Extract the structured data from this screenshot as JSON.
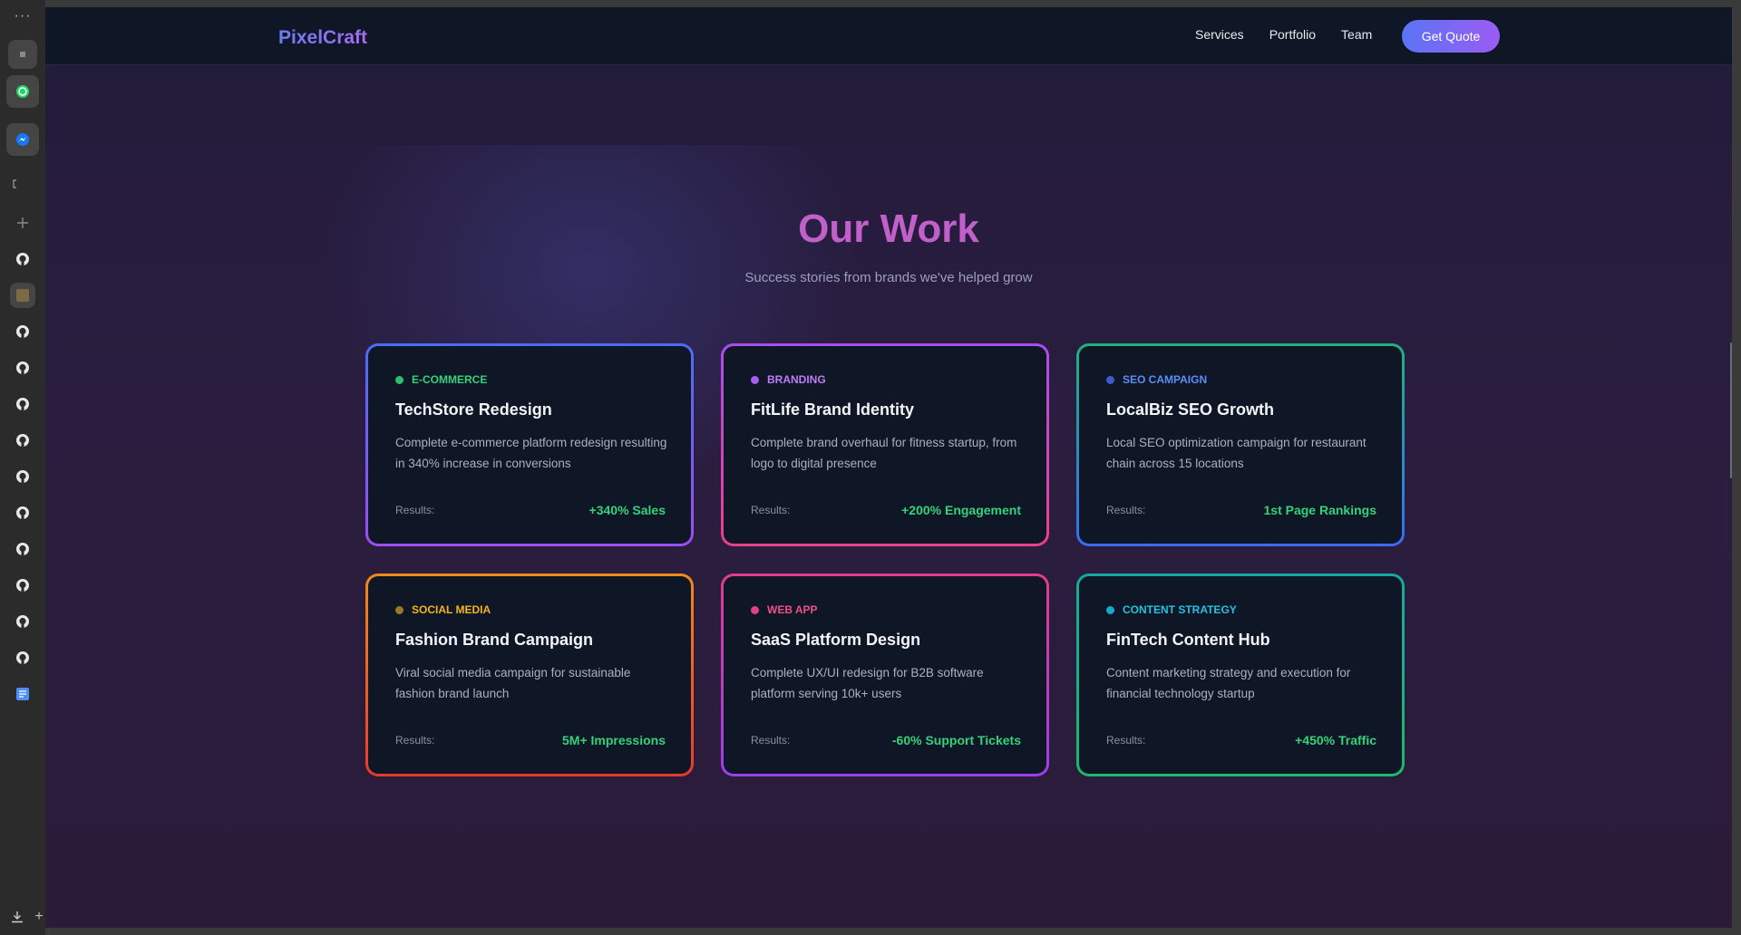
{
  "browser": {
    "menu_glyph": "···",
    "plus_glyph": "+"
  },
  "nav": {
    "brand": "PixelCraft",
    "links": [
      "Services",
      "Portfolio",
      "Team"
    ],
    "cta": "Get Quote"
  },
  "section": {
    "title": "Our Work",
    "subtitle": "Success stories from brands we've helped grow"
  },
  "results_label": "Results:",
  "projects": [
    {
      "category": "E-COMMERCE",
      "title": "TechStore Redesign",
      "description": "Complete e-commerce platform redesign resulting in 340% increase in conversions",
      "result": "+340% Sales",
      "tag_color": "#34d27a",
      "dot_color": "#2fbf6a",
      "border_colors": [
        "#4a6cf7",
        "#9b4ff0"
      ]
    },
    {
      "category": "BRANDING",
      "title": "FitLife Brand Identity",
      "description": "Complete brand overhaul for fitness startup, from logo to digital presence",
      "result": "+200% Engagement",
      "tag_color": "#c07cf4",
      "dot_color": "#a95cf0",
      "border_colors": [
        "#a84ef0",
        "#ec3f8a"
      ]
    },
    {
      "category": "SEO CAMPAIGN",
      "title": "LocalBiz SEO Growth",
      "description": "Local SEO optimization campaign for restaurant chain across 15 locations",
      "result": "1st Page Rankings",
      "tag_color": "#5b8ef6",
      "dot_color": "#3b5cc8",
      "border_colors": [
        "#1fb27a",
        "#3a6cf2"
      ]
    },
    {
      "category": "SOCIAL MEDIA",
      "title": "Fashion Brand Campaign",
      "description": "Viral social media campaign for sustainable fashion brand launch",
      "result": "5M+ Impressions",
      "tag_color": "#f2b51c",
      "dot_color": "#9a7a26",
      "border_colors": [
        "#f08b1b",
        "#e63a2f"
      ]
    },
    {
      "category": "WEB APP",
      "title": "SaaS Platform Design",
      "description": "Complete UX/UI redesign for B2B software platform serving 10k+ users",
      "result": "-60% Support Tickets",
      "tag_color": "#ee4f8a",
      "dot_color": "#e0437f",
      "border_colors": [
        "#e43b8c",
        "#9a3ff0"
      ]
    },
    {
      "category": "CONTENT STRATEGY",
      "title": "FinTech Content Hub",
      "description": "Content marketing strategy and execution for financial technology startup",
      "result": "+450% Traffic",
      "tag_color": "#21c3e3",
      "dot_color": "#13a9c8",
      "border_colors": [
        "#16a8a0",
        "#1bb86e"
      ]
    }
  ]
}
